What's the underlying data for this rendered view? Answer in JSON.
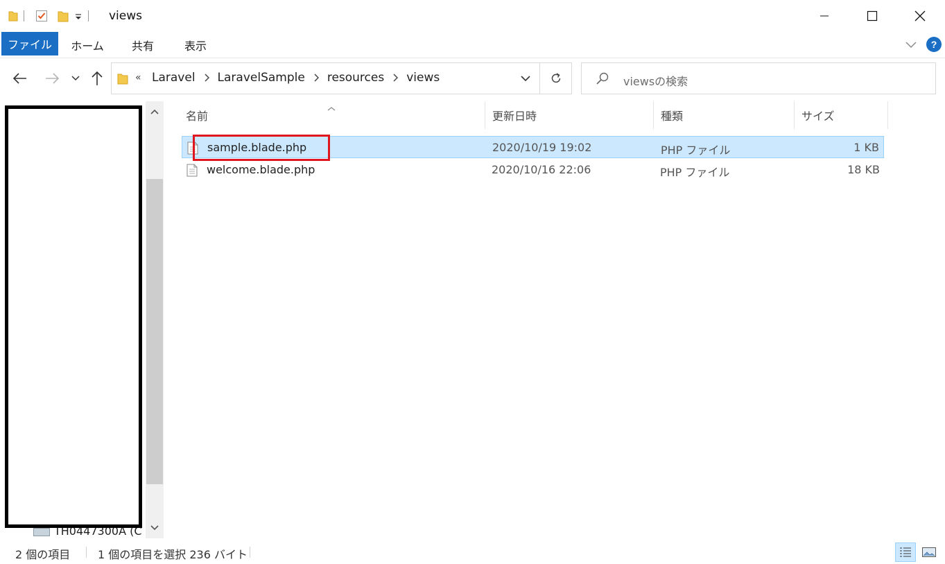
{
  "window": {
    "title": "views"
  },
  "ribbon": {
    "tabs": [
      {
        "label": "ファイル"
      },
      {
        "label": "ホーム"
      },
      {
        "label": "共有"
      },
      {
        "label": "表示"
      }
    ],
    "help_label": "?"
  },
  "address": {
    "overflow": "«",
    "crumbs": [
      "Laravel",
      "LaravelSample",
      "resources",
      "views"
    ]
  },
  "search": {
    "placeholder": "viewsの検索"
  },
  "nav_pane": {
    "bottom_item": "TH0447300A (C"
  },
  "columns": {
    "name": "名前",
    "date": "更新日時",
    "type": "種類",
    "size": "サイズ"
  },
  "files": [
    {
      "name": "sample.blade.php",
      "date": "2020/10/19 19:02",
      "type": "PHP ファイル",
      "size": "1 KB",
      "selected": true
    },
    {
      "name": "welcome.blade.php",
      "date": "2020/10/16 22:06",
      "type": "PHP ファイル",
      "size": "18 KB",
      "selected": false
    }
  ],
  "status": {
    "item_count": "2 個の項目",
    "selection": "1 個の項目を選択  236 バイト"
  },
  "colors": {
    "accent": "#1a6fc4",
    "selection_bg": "#cce8ff",
    "highlight_box": "#e0161e"
  }
}
